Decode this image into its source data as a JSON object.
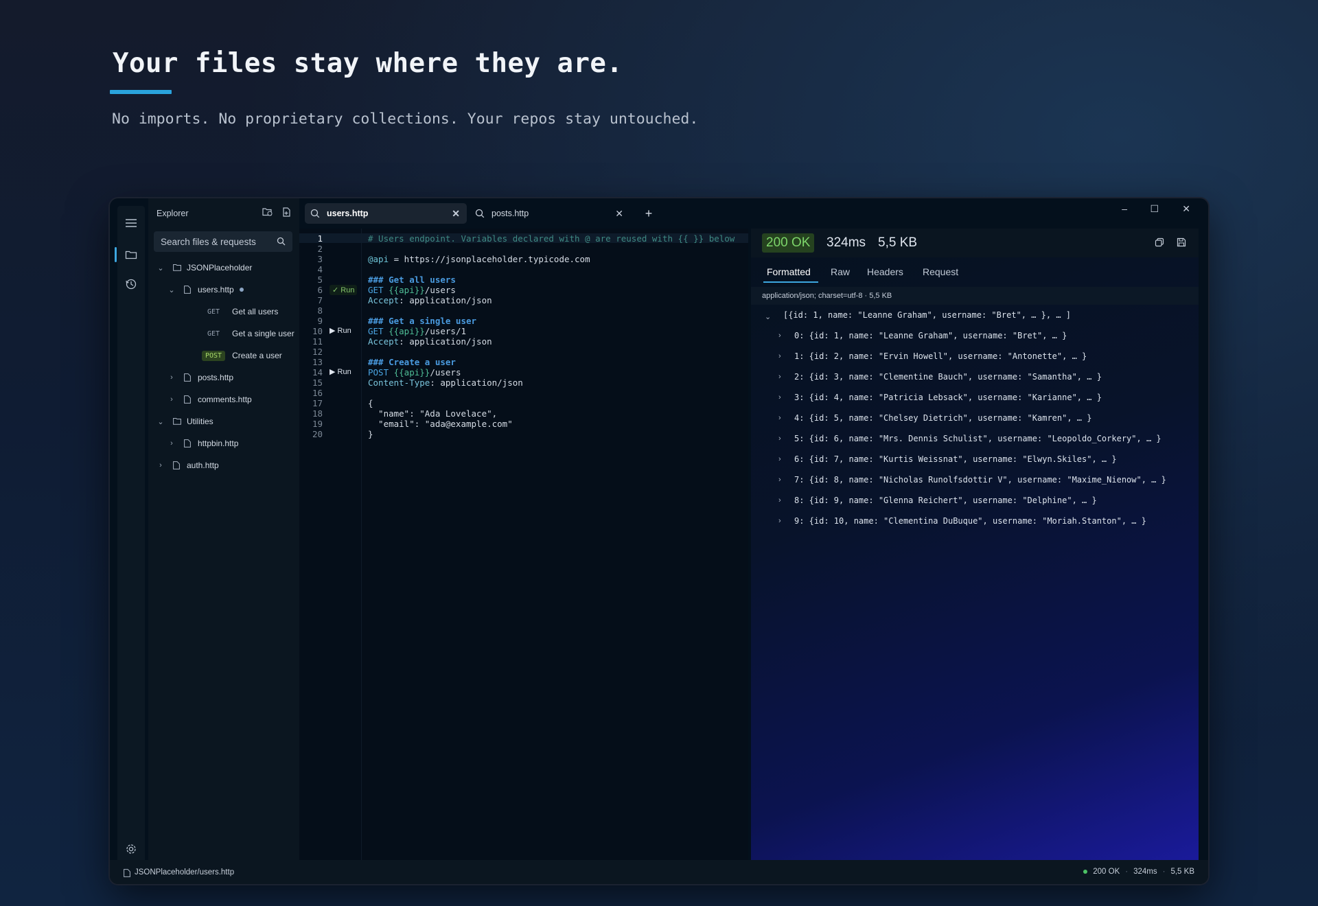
{
  "hero": {
    "title": "Your files stay where they are.",
    "subtitle": "No imports. No proprietary collections. Your repos stay untouched."
  },
  "explorer": {
    "title": "Explorer",
    "search_placeholder": "Search files & requests",
    "tree": {
      "root1": "JSONPlaceholder",
      "file_users": "users.http",
      "req1_method": "GET",
      "req1_name": "Get all users",
      "req2_method": "GET",
      "req2_name": "Get a single user",
      "req3_method": "POST",
      "req3_name": "Create a user",
      "file_posts": "posts.http",
      "file_comments": "comments.http",
      "root2": "Utilities",
      "file_httpbin": "httpbin.http",
      "file_auth": "auth.http"
    }
  },
  "tabs": {
    "tab1": "users.http",
    "tab2": "posts.http",
    "new_tab": "+"
  },
  "editor": {
    "line_numbers": [
      "1",
      "2",
      "3",
      "4",
      "5",
      "6",
      "7",
      "8",
      "9",
      "10",
      "11",
      "12",
      "13",
      "14",
      "15",
      "16",
      "17",
      "18",
      "19",
      "20"
    ],
    "run_ok": "✓ Run",
    "run": "▶ Run",
    "code": {
      "l1": "# Users endpoint. Variables declared with @ are reused with {{ }} below",
      "l3_var": "@api",
      "l3_rest": " = https://jsonplaceholder.typicode.com",
      "l5": "### Get all users",
      "l6_method": "GET",
      "l6_tpl": " {{api}}",
      "l6_rest": "/users",
      "l7_key": "Accept",
      "l7_rest": ": application/json",
      "l9": "### Get a single user",
      "l10_method": "GET",
      "l10_tpl": " {{api}}",
      "l10_rest": "/users/1",
      "l11_key": "Accept",
      "l11_rest": ": application/json",
      "l13": "### Create a user",
      "l14_method": "POST",
      "l14_tpl": " {{api}}",
      "l14_rest": "/users",
      "l15_key": "Content-Type",
      "l15_rest": ": application/json",
      "l17": "{",
      "l18": "  \"name\": \"Ada Lovelace\",",
      "l19": "  \"email\": \"ada@example.com\"",
      "l20": "}"
    }
  },
  "response": {
    "status": "200 OK",
    "time": "324ms",
    "size": "5,5 KB",
    "status_color": "#7dd66a",
    "tabs": [
      "Formatted",
      "Raw",
      "Headers",
      "Request"
    ],
    "content_type": "application/json; charset=utf-8 · 5,5 KB",
    "root": "[{id: 1, name: \"Leanne Graham\", username: \"Bret\", … }, … ]",
    "items": [
      "0: {id: 1, name: \"Leanne Graham\", username: \"Bret\", … }",
      "1: {id: 2, name: \"Ervin Howell\", username: \"Antonette\", … }",
      "2: {id: 3, name: \"Clementine Bauch\", username: \"Samantha\", … }",
      "3: {id: 4, name: \"Patricia Lebsack\", username: \"Karianne\", … }",
      "4: {id: 5, name: \"Chelsey Dietrich\", username: \"Kamren\", … }",
      "5: {id: 6, name: \"Mrs. Dennis Schulist\", username: \"Leopoldo_Corkery\", … }",
      "6: {id: 7, name: \"Kurtis Weissnat\", username: \"Elwyn.Skiles\", … }",
      "7: {id: 8, name: \"Nicholas Runolfsdottir V\", username: \"Maxime_Nienow\", … }",
      "8: {id: 9, name: \"Glenna Reichert\", username: \"Delphine\", … }",
      "9: {id: 10, name: \"Clementina DuBuque\", username: \"Moriah.Stanton\", … }"
    ]
  },
  "statusbar": {
    "path": "JSONPlaceholder/users.http",
    "status": "200 OK",
    "time": "324ms",
    "size": "5,5 KB",
    "sep": "·"
  },
  "window": {
    "minimize": "–",
    "maximize": "☐",
    "close": "✕"
  }
}
